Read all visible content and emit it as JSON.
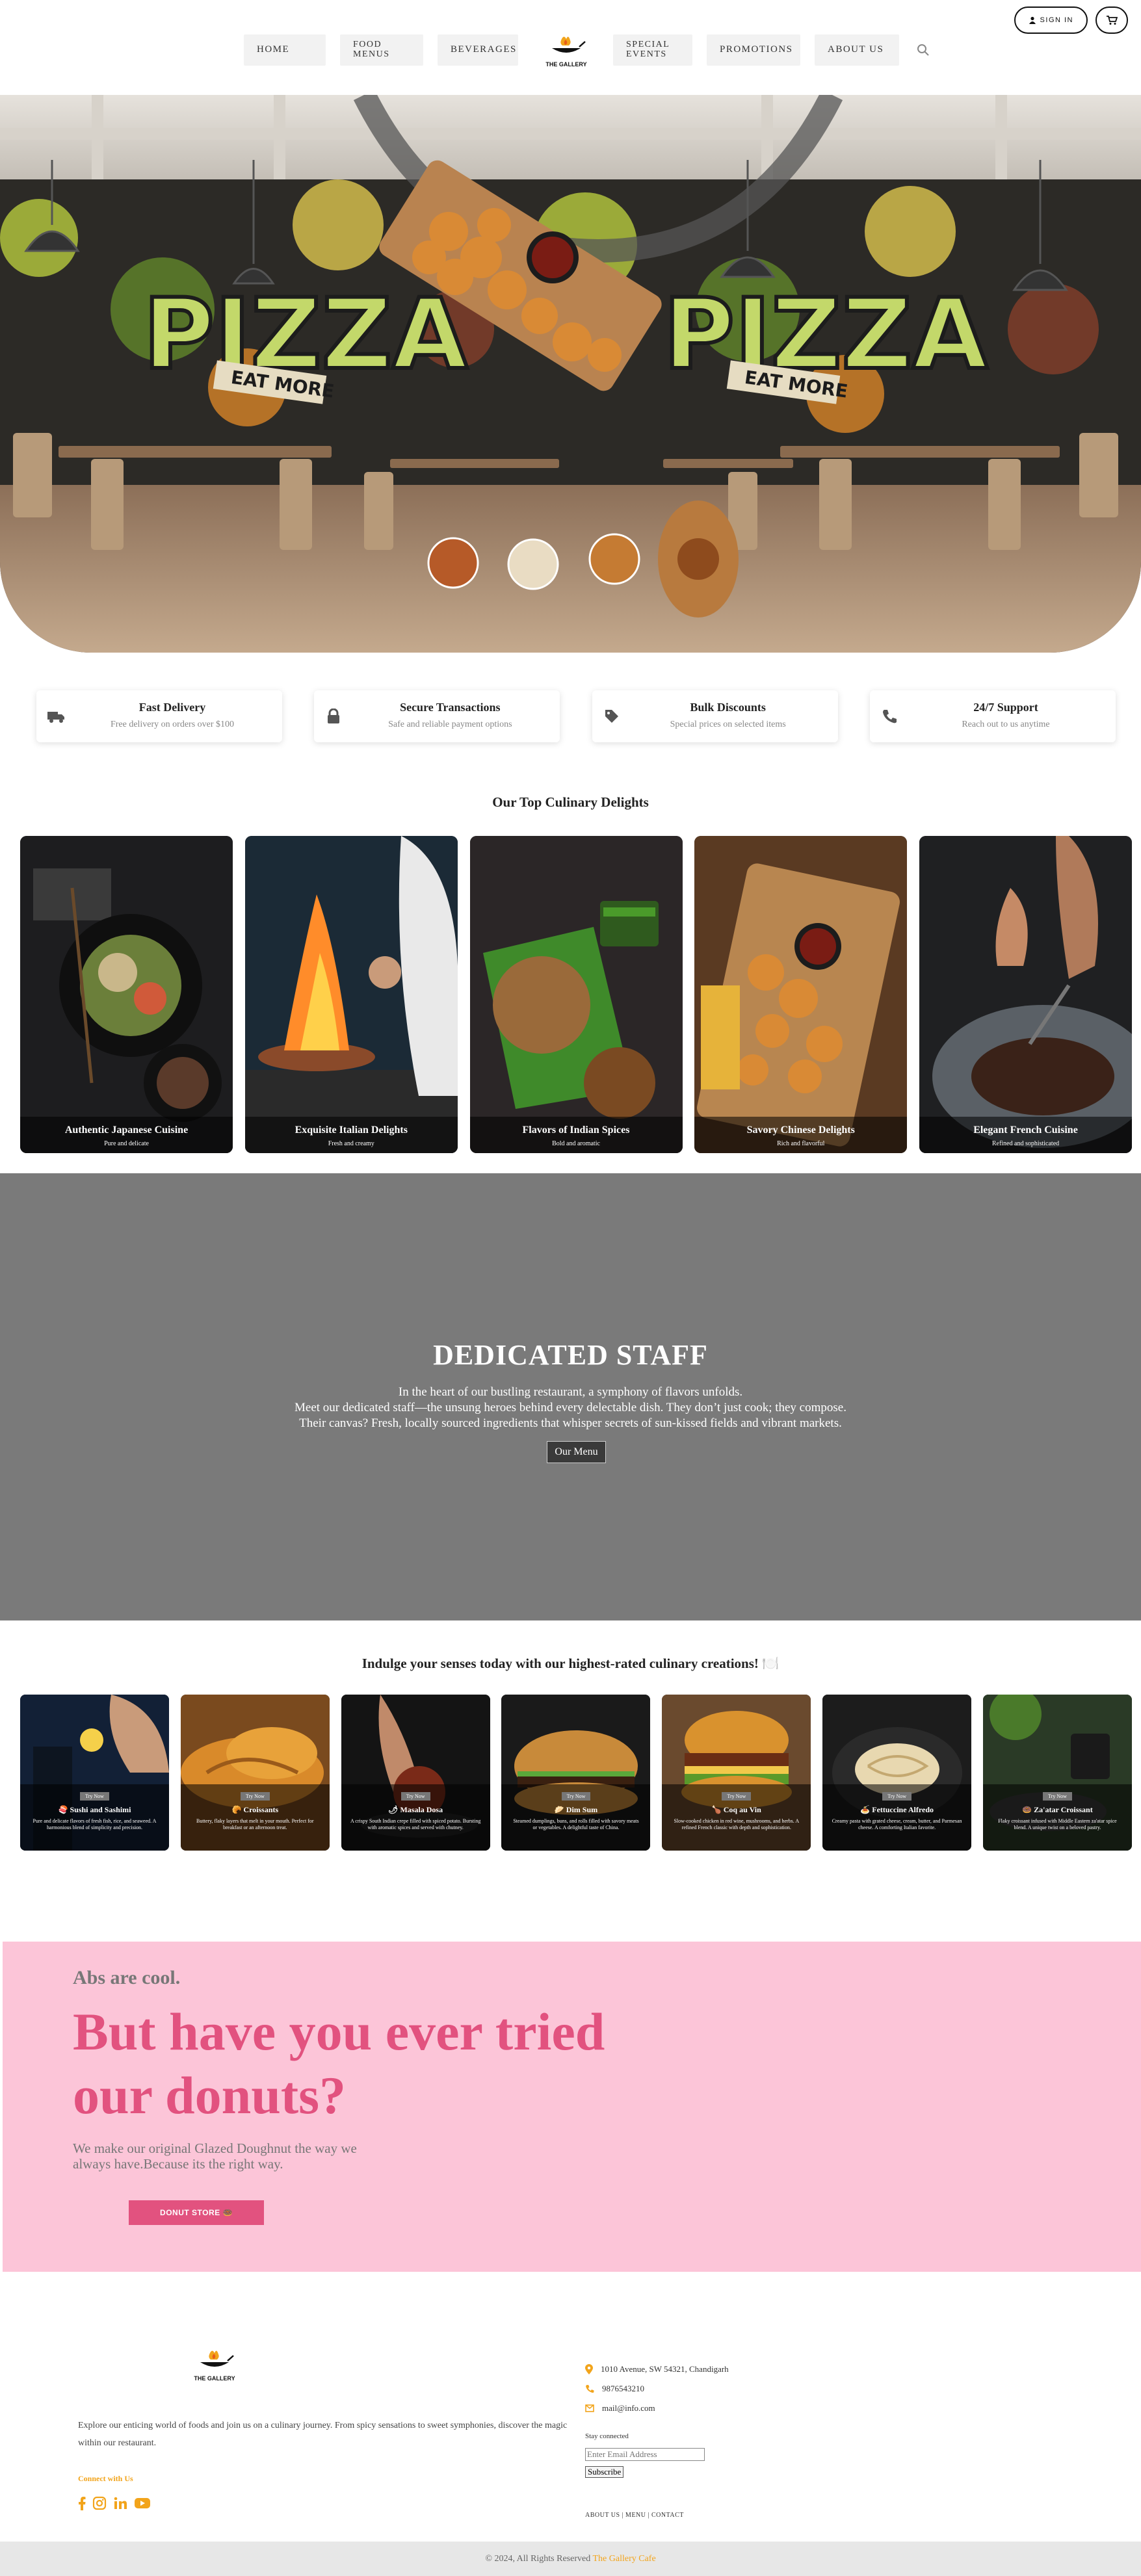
{
  "nav": {
    "items": [
      "HOME",
      "FOOD MENUS",
      "BEVERAGES",
      "SPECIAL EVENTS",
      "PROMOTIONS",
      "ABOUT US"
    ],
    "logo_text": "THE GALLERY",
    "signin": "SIGN IN"
  },
  "hero": {
    "wall_text_left": "PIZZA",
    "wall_text_right": "PIZZA",
    "banner_left": "EAT MORE",
    "banner_right": "EAT MORE",
    "carousel_thumbs": 4,
    "active_thumb": 4
  },
  "features": [
    {
      "icon": "truck-icon",
      "title": "Fast Delivery",
      "subtitle": "Free delivery on orders over $100"
    },
    {
      "icon": "lock-icon",
      "title": "Secure Transactions",
      "subtitle": "Safe and reliable payment options"
    },
    {
      "icon": "tag-icon",
      "title": "Bulk Discounts",
      "subtitle": "Special prices on selected items"
    },
    {
      "icon": "phone-icon",
      "title": "24/7 Support",
      "subtitle": "Reach out to us anytime"
    }
  ],
  "delights": {
    "title": "Our Top Culinary Delights",
    "items": [
      {
        "title": "Authentic Japanese Cuisine",
        "subtitle": "Pure and delicate"
      },
      {
        "title": "Exquisite Italian Delights",
        "subtitle": "Fresh and creamy"
      },
      {
        "title": "Flavors of Indian Spices",
        "subtitle": "Bold and aromatic"
      },
      {
        "title": "Savory Chinese Delights",
        "subtitle": "Rich and flavorful"
      },
      {
        "title": "Elegant French Cuisine",
        "subtitle": "Refined and sophisticated"
      }
    ]
  },
  "staff": {
    "heading": "DEDICATED STAFF",
    "line1": "In the heart of our bustling restaurant, a symphony of flavors unfolds.",
    "line2": "Meet our dedicated staff—the unsung heroes behind every delectable dish. They don’t just cook; they compose.",
    "line3": "Their canvas? Fresh, locally sourced ingredients that whisper secrets of sun-kissed fields and vibrant markets.",
    "button": "Our Menu"
  },
  "rated": {
    "title": "Indulge your senses today with our highest-rated culinary creations! 🍽️",
    "try_label": "Try Now",
    "items": [
      {
        "emoji": "🍣",
        "name": "Sushi and Sashimi",
        "desc": "Pure and delicate flavors of fresh fish, rice, and seaweed. A harmonious blend of simplicity and precision."
      },
      {
        "emoji": "🥐",
        "name": "Croissants",
        "desc": "Buttery, flaky layers that melt in your mouth. Perfect for breakfast or an afternoon treat."
      },
      {
        "emoji": "🌶",
        "name": "Masala Dosa",
        "desc": "A crispy South Indian crepe filled with spiced potato. Bursting with aromatic spices and served with chutney."
      },
      {
        "emoji": "🥟",
        "name": "Dim Sum",
        "desc": "Steamed dumplings, buns, and rolls filled with savory meats or vegetables. A delightful taste of China."
      },
      {
        "emoji": "🍗",
        "name": "Coq au Vin",
        "desc": "Slow-cooked chicken in red wine, mushrooms, and herbs. A refined French classic with depth and sophistication."
      },
      {
        "emoji": "🍝",
        "name": "Fettuccine Alfredo",
        "desc": "Creamy pasta with grated cheese, cream, butter, and Parmesan cheese. A comforting Italian favorite."
      },
      {
        "emoji": "🍩",
        "name": "Za'atar Croissant",
        "desc": "Flaky croissant infused with Middle Eastern za'atar spice blend. A unique twist on a beloved pastry."
      }
    ]
  },
  "donut": {
    "kicker": "Abs are cool.",
    "headline": "But have you ever tried our donuts?",
    "body": "We make our original Glazed Doughnut the way we always have.Because its the right way.",
    "button": "DONUT STORE 🍩"
  },
  "footer": {
    "logo_text": "THE GALLERY",
    "about": "Explore our enticing world of foods and join us on a culinary journey. From spicy sensations to sweet symphonies, discover the magic within our restaurant.",
    "connect_label": "Connect with Us",
    "address": "1010 Avenue, SW 54321, Chandigarh",
    "phone": "9876543210",
    "email": "mail@info.com",
    "stay_connected": "Stay connected",
    "email_placeholder": "Enter Email Address",
    "subscribe": "Subscribe",
    "links": "ABOUT US | MENU | CONTACT",
    "copyright_prefix": "© 2024, All Rights Reserved",
    "copyright_brand": "The Gallery Cafe"
  },
  "colors": {
    "accent": "#f2a41b",
    "donut_pink": "#e2527f",
    "donut_bg": "#fcc5d8",
    "staff_bg": "#7a7a7a"
  }
}
